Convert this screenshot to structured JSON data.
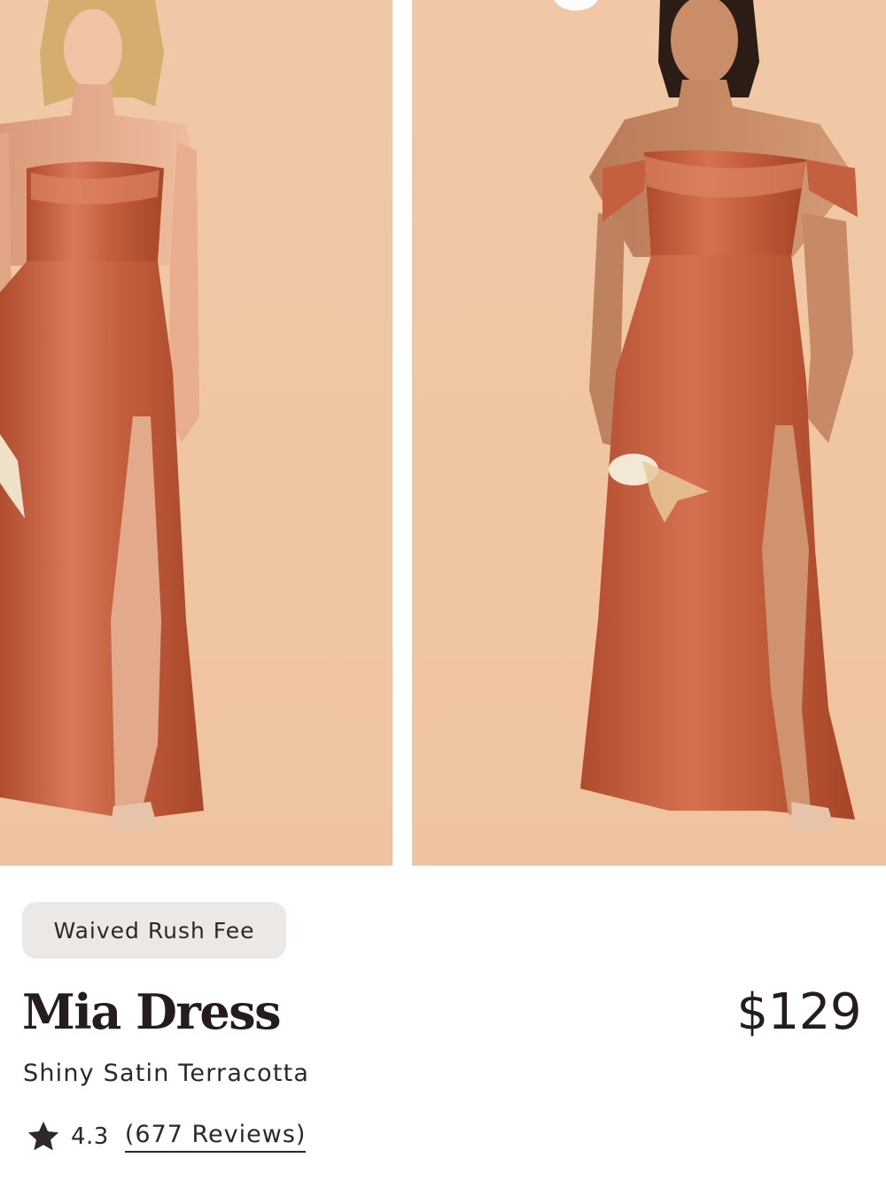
{
  "product": {
    "badge": "Waived Rush Fee",
    "name": "Mia Dress",
    "price": "$129",
    "variant": "Shiny Satin Terracotta",
    "rating": "4.3",
    "reviews_link": "(677 Reviews)"
  },
  "gallery": {
    "images": [
      {
        "semantic": "model-photo-strapless-gown"
      },
      {
        "semantic": "model-photo-off-shoulder-gown"
      }
    ]
  },
  "icons": {
    "rating": "star-icon"
  },
  "colors": {
    "dress": "#c45f3e",
    "backdrop": "#f0c6a2",
    "badge_bg": "#ece8e6",
    "text": "#241d1b"
  }
}
